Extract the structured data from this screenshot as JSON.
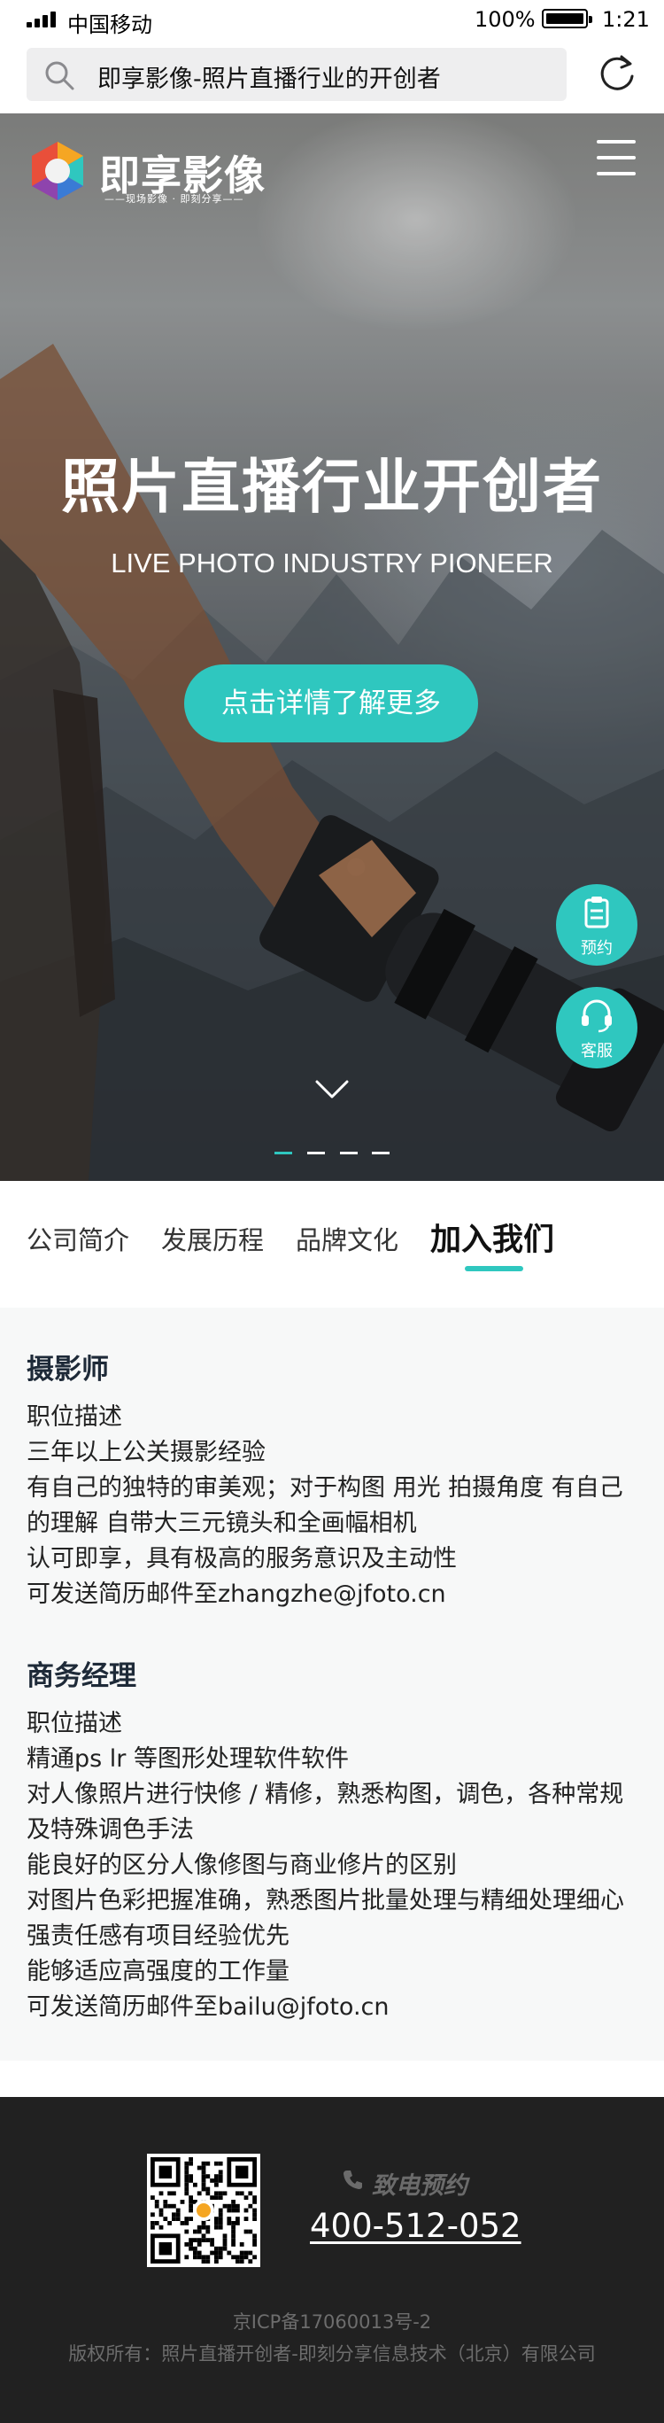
{
  "status_bar": {
    "carrier": "中国移动",
    "battery": "100%",
    "time": "1:21"
  },
  "browser": {
    "url_title": "即享影像-照片直播行业的开创者"
  },
  "hero": {
    "logo_text": "即享影像",
    "logo_slogan": "——现场影像 · 即刻分享——",
    "title": "照片直播行业开创者",
    "subtitle": "LIVE PHOTO INDUSTRY PIONEER",
    "cta_label": "点击详情了解更多",
    "side_buttons": {
      "booking": "预约",
      "service": "客服"
    },
    "slide_count": 4,
    "active_slide": 1
  },
  "tabs": [
    {
      "label": "公司简介"
    },
    {
      "label": "发展历程"
    },
    {
      "label": "品牌文化"
    },
    {
      "label": "加入我们"
    }
  ],
  "active_tab": "加入我们",
  "jobs": [
    {
      "title": "摄影师",
      "lines": [
        "职位描述",
        "三年以上公关摄影经验",
        "有自己的独特的审美观；对于构图 用光 拍摄角度 有自己的理解 自带大三元镜头和全画幅相机",
        "认可即享，具有极高的服务意识及主动性",
        "可发送简历邮件至zhangzhe@jfoto.cn"
      ]
    },
    {
      "title": "商务经理",
      "lines": [
        "职位描述",
        "精通ps lr 等图形处理软件软件",
        "对人像照片进行快修 / 精修，熟悉构图，调色，各种常规及特殊调色手法",
        "能良好的区分人像修图与商业修片的区别",
        "对图片色彩把握准确，熟悉图片批量处理与精细处理细心",
        "强责任感有项目经验优先",
        "能够适应高强度的工作量",
        "可发送简历邮件至bailu@jfoto.cn"
      ]
    }
  ],
  "footer": {
    "phone_label": "致电预约",
    "phone_number": "400-512-052",
    "icp": "京ICP备17060013号-2",
    "copyright": "版权所有：照片直播开创者-即刻分享信息技术（北京）有限公司"
  },
  "colors": {
    "accent": "#2fc7bf",
    "footer_bg": "#212121",
    "content_bg": "#f7f8f8"
  }
}
